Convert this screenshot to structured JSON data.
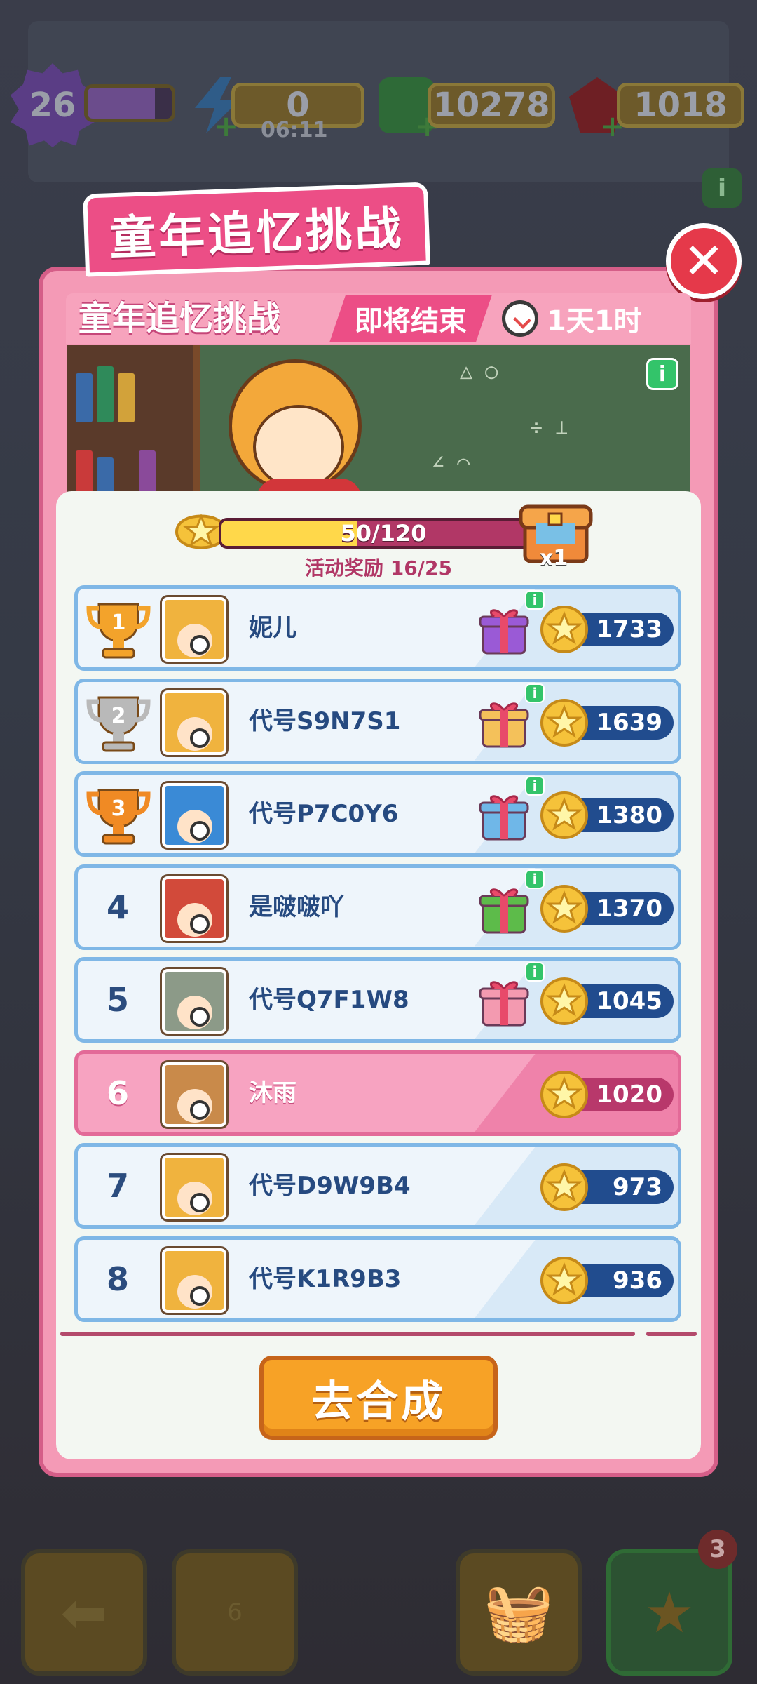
{
  "hud": {
    "level": "26",
    "energy": "0",
    "energy_timer": "06:11",
    "cash": "10278",
    "gems": "1018",
    "info_label": "i"
  },
  "bottom_bar": {
    "trophy_count": "6",
    "star_badge": "3"
  },
  "modal": {
    "tab_title": "童年追忆挑战",
    "close_label": "✕",
    "event_title": "童年追忆挑战",
    "ending_tag": "即将结束",
    "time_left": "1天1时",
    "info_label": "i",
    "progress_text": "50/120",
    "progress_value": 0.4167,
    "reward_progress": "活动奖励 16/25",
    "chest_multiplier": "x1",
    "go_button": "去合成"
  },
  "ranking": [
    {
      "rank": "1",
      "name": "妮儿",
      "score": "1733",
      "gift": "purple",
      "me": false
    },
    {
      "rank": "2",
      "name": "代号S9N7S1",
      "score": "1639",
      "gift": "pink-gold",
      "me": false
    },
    {
      "rank": "3",
      "name": "代号P7C0Y6",
      "score": "1380",
      "gift": "blue",
      "me": false
    },
    {
      "rank": "4",
      "name": "是啵啵吖",
      "score": "1370",
      "gift": "green",
      "me": false
    },
    {
      "rank": "5",
      "name": "代号Q7F1W8",
      "score": "1045",
      "gift": "pink",
      "me": false
    },
    {
      "rank": "6",
      "name": "沐雨",
      "score": "1020",
      "gift": "",
      "me": true
    },
    {
      "rank": "7",
      "name": "代号D9W9B4",
      "score": "973",
      "gift": "",
      "me": false
    },
    {
      "rank": "8",
      "name": "代号K1R9B3",
      "score": "936",
      "gift": "",
      "me": false
    }
  ],
  "colors": {
    "accent_pink": "#ec4e86",
    "score_blue": "#214c8e",
    "gold": "#ffd84a"
  }
}
